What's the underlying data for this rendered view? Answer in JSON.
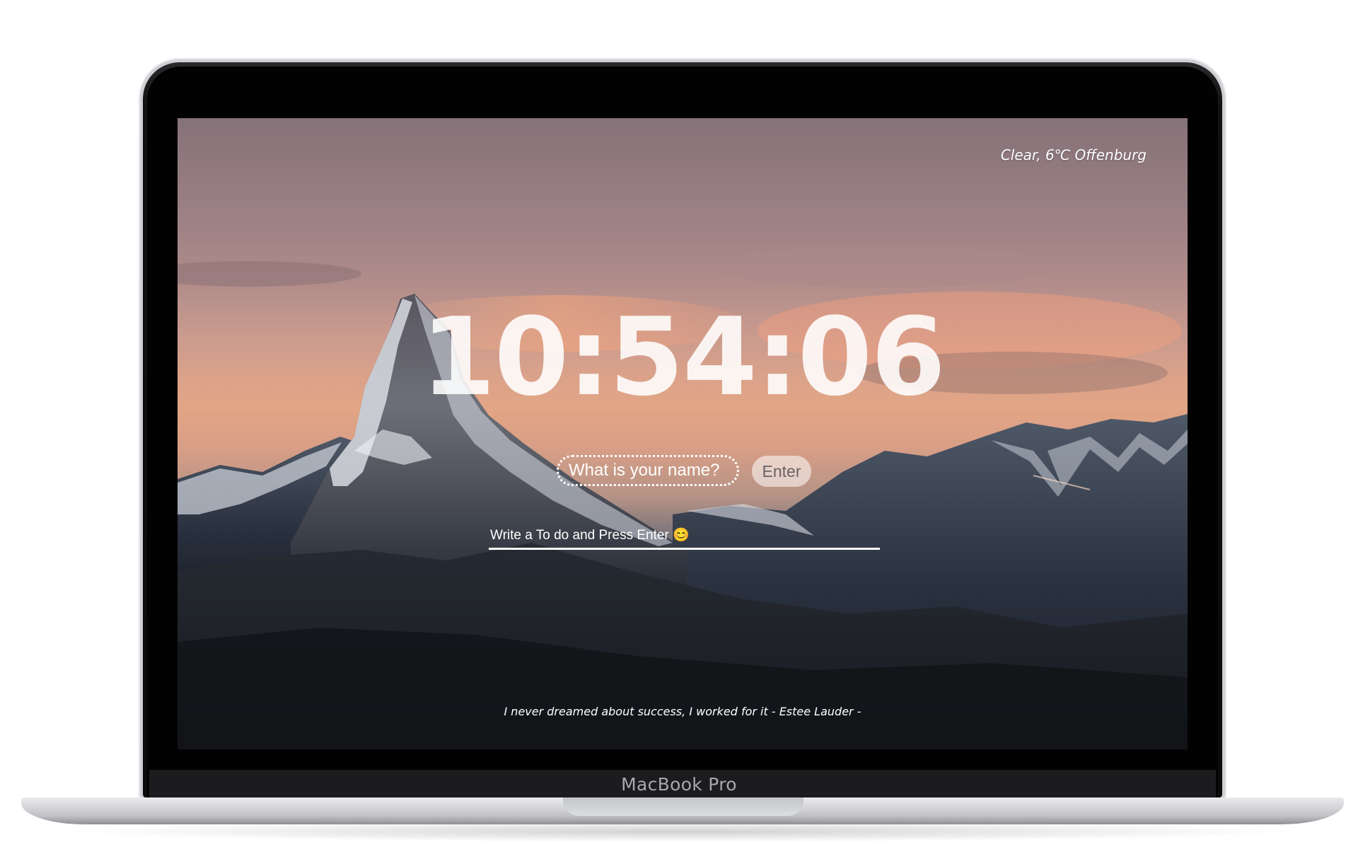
{
  "device": {
    "brand_label": "MacBook Pro"
  },
  "screen": {
    "weather": "Clear, 6℃ Offenburg",
    "clock": "10:54:06",
    "name_prompt": {
      "placeholder": "What is your name?",
      "value": ""
    },
    "enter_button_label": "Enter",
    "todo": {
      "placeholder": "Write a To do and Press Enter 😊",
      "value": ""
    },
    "quote": "I never dreamed about success, I worked for it - Estee Lauder -"
  },
  "colors": {
    "sky_top": "#857278",
    "sky_glow": "#e2a585",
    "mountain_dark": "#1d222c",
    "text": "#ffffff"
  }
}
